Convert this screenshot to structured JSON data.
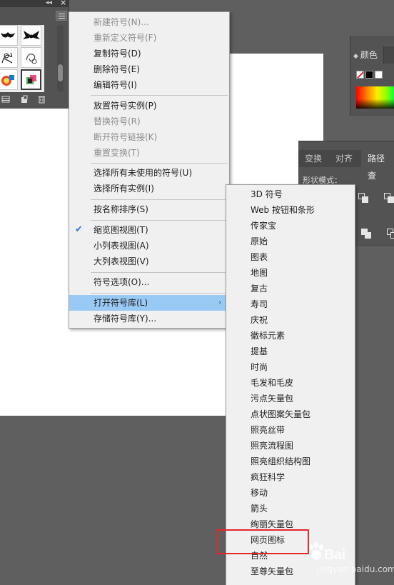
{
  "colors": {
    "background": "#5f5f5f",
    "menu_bg": "#f0f0f0",
    "menu_highlight": "#99c9f5",
    "check": "#2e7ad1",
    "annotation": "#e8262d"
  },
  "symbols_panel": {
    "icons": [
      "collapse-icon",
      "close-icon",
      "panel-menu-icon",
      "symbol-library-icon",
      "new-symbol-icon",
      "delete-symbol-icon"
    ]
  },
  "color_panel": {
    "tab_label": "颜色",
    "tab_chevron": "◆"
  },
  "pathfinder_panel": {
    "tabs": [
      "变换",
      "对齐",
      "路径查"
    ],
    "shape_mode_label": "形状模式："
  },
  "main_menu": {
    "items": [
      {
        "label": "新建符号(N)...",
        "disabled": true
      },
      {
        "label": "重新定义符号(F)",
        "disabled": true
      },
      {
        "label": "复制符号(D)",
        "disabled": false
      },
      {
        "label": "删除符号(E)",
        "disabled": false
      },
      {
        "label": "编辑符号(I)",
        "disabled": false
      },
      {
        "label": "放置符号实例(P)",
        "disabled": false
      },
      {
        "label": "替换符号(R)",
        "disabled": true
      },
      {
        "label": "断开符号链接(K)",
        "disabled": true
      },
      {
        "label": "重置变换(T)",
        "disabled": true
      },
      {
        "label": "选择所有未使用的符号(U)",
        "disabled": false
      },
      {
        "label": "选择所有实例(I)",
        "disabled": false
      },
      {
        "label": "按名称排序(S)",
        "disabled": false
      },
      {
        "label": "缩览图视图(T)",
        "disabled": false,
        "checked": true
      },
      {
        "label": "小列表视图(A)",
        "disabled": false
      },
      {
        "label": "大列表视图(V)",
        "disabled": false
      },
      {
        "label": "符号选项(O)...",
        "disabled": false
      },
      {
        "label": "打开符号库(L)",
        "disabled": false,
        "highlighted": true,
        "submenu_arrow": "›"
      },
      {
        "label": "存储符号库(Y)...",
        "disabled": false
      }
    ]
  },
  "sub_menu": {
    "items": [
      "3D 符号",
      "Web 按钮和条形",
      "传家宝",
      "原始",
      "图表",
      "地图",
      "复古",
      "寿司",
      "庆祝",
      "徽标元素",
      "提基",
      "时尚",
      "毛发和毛皮",
      "污点矢量包",
      "点状图案矢量包",
      "照亮丝带",
      "照亮流程图",
      "照亮组织结构图",
      "疯狂科学",
      "移动",
      "箭头",
      "绚丽矢量包",
      "网页图标",
      "自然",
      "至尊矢量包"
    ],
    "annotated_item": "网页图标"
  },
  "watermark": {
    "text": "Bai",
    "sub": "jingyan.baidu.com"
  }
}
